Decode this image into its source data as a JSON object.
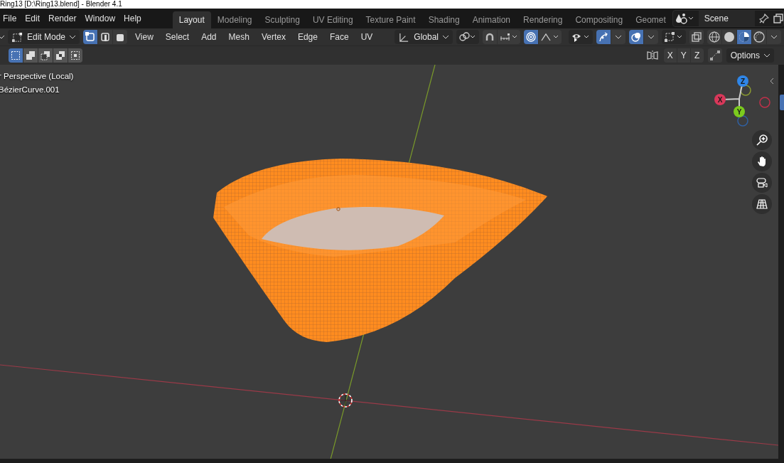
{
  "window": {
    "title": "Ring13 [D:\\Ring13.blend] - Blender 4.1"
  },
  "menu": [
    "File",
    "Edit",
    "Render",
    "Window",
    "Help"
  ],
  "workspaces": [
    {
      "label": "Layout",
      "selected": true
    },
    {
      "label": "Modeling",
      "selected": false
    },
    {
      "label": "Sculpting",
      "selected": false
    },
    {
      "label": "UV Editing",
      "selected": false
    },
    {
      "label": "Texture Paint",
      "selected": false
    },
    {
      "label": "Shading",
      "selected": false
    },
    {
      "label": "Animation",
      "selected": false
    },
    {
      "label": "Rendering",
      "selected": false
    },
    {
      "label": "Compositing",
      "selected": false
    },
    {
      "label": "Geomet",
      "selected": false
    }
  ],
  "scene": {
    "name": "Scene"
  },
  "header": {
    "mode": "Edit Mode",
    "select_modes": [
      {
        "kind": "vertex",
        "selected": true
      },
      {
        "kind": "edge",
        "selected": false
      },
      {
        "kind": "face",
        "selected": false
      }
    ],
    "menus": [
      "View",
      "Select",
      "Add",
      "Mesh",
      "Vertex",
      "Edge",
      "Face",
      "UV"
    ],
    "orientation": "Global",
    "snap": {
      "on": false
    },
    "proportional_editing": {
      "on": true
    },
    "show_gizmo": {
      "on": true
    },
    "show_overlays": {
      "on": true
    },
    "xray": {
      "on": false
    },
    "shading": [
      {
        "kind": "wireframe",
        "selected": false
      },
      {
        "kind": "solid",
        "selected": false
      },
      {
        "kind": "material",
        "selected": true
      },
      {
        "kind": "rendered",
        "selected": false
      }
    ]
  },
  "tool_header": {
    "select_box_modes": [
      {
        "kind": "new",
        "selected": true
      },
      {
        "kind": "extend",
        "selected": false
      },
      {
        "kind": "subtract",
        "selected": false
      },
      {
        "kind": "difference",
        "selected": false
      },
      {
        "kind": "intersect",
        "selected": false
      }
    ],
    "mirror_axes": [
      {
        "label": "X",
        "on": false
      },
      {
        "label": "Y",
        "on": false
      },
      {
        "label": "Z",
        "on": false
      }
    ],
    "options": "Options"
  },
  "viewport": {
    "overlay_lines": [
      "r Perspective (Local)",
      "BézierCurve.001"
    ],
    "gizmo_axes": [
      {
        "label": "Z",
        "color": "#2f86e8"
      },
      {
        "label": "X",
        "color": "#d9385a"
      },
      {
        "label": "Y",
        "color": "#7ccb1e"
      }
    ]
  }
}
